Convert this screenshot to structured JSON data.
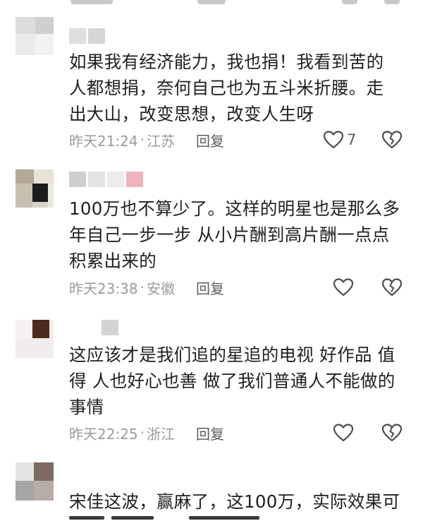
{
  "comments": [
    {
      "text": "如果我有经济能力，我也捐！我看到苦的\n人都想捐，奈何自己也为五斗米折腰。走\n出大山，改变思想，改变人生呀",
      "time": "昨天21:24",
      "location": "江苏",
      "reply_label": "回复",
      "like_count": "7"
    },
    {
      "text": "100万也不算少了。这样的明星也是那么多\n年自己一步一步 从小片酬到高片酬一点点\n积累出来的",
      "time": "昨天23:38",
      "location": "安徽",
      "reply_label": "回复"
    },
    {
      "text": "这应该才是我们追的星追的电视 好作品 值\n得 人也好心也善 做了我们普通人不能做的\n事情",
      "time": "昨天22:25",
      "location": "浙江",
      "reply_label": "回复"
    },
    {
      "text": "宋佳这波，赢麻了，这100万，实际效果可"
    }
  ],
  "meta_separator": "·",
  "icons": {
    "like": "heart-outline-icon",
    "dislike": "broken-heart-icon"
  },
  "colors": {
    "text": "#1f1f1f",
    "meta": "#9a9a9a",
    "action": "#5c5c5c"
  }
}
